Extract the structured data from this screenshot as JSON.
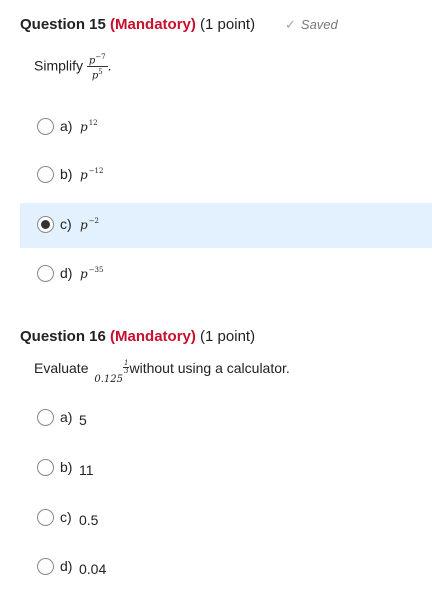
{
  "q15": {
    "number_label": "Question 15",
    "mandatory": "(Mandatory)",
    "points": "(1 point)",
    "saved": "Saved",
    "prompt_text": "Simplify",
    "math_num": "p",
    "math_num_exp": "−7",
    "math_den": "p",
    "math_den_exp": "5",
    "prompt_end": ".",
    "options": [
      {
        "letter": "a)",
        "base": "p",
        "exp": "12",
        "selected": false
      },
      {
        "letter": "b)",
        "base": "p",
        "exp": "−12",
        "selected": false
      },
      {
        "letter": "c)",
        "base": "p",
        "exp": "−2",
        "selected": true
      },
      {
        "letter": "d)",
        "base": "p",
        "exp": "−35",
        "selected": false
      }
    ]
  },
  "q16": {
    "number_label": "Question 16",
    "mandatory": "(Mandatory)",
    "points": "(1 point)",
    "prompt_text": "Evaluate",
    "math_base": "0.125",
    "math_exp_num": "1",
    "math_exp_den": "3",
    "prompt_rest": "without using a calculator.",
    "options": [
      {
        "letter": "a)",
        "value": "5",
        "selected": false
      },
      {
        "letter": "b)",
        "value": "11",
        "selected": false
      },
      {
        "letter": "c)",
        "value": "0.5",
        "selected": false
      },
      {
        "letter": "d)",
        "value": "0.04",
        "selected": false
      }
    ]
  },
  "colors": {
    "mandatory": "#c8102e",
    "selected_row": "#e3f0fd"
  },
  "icons": {
    "saved": "checkmark-icon"
  }
}
